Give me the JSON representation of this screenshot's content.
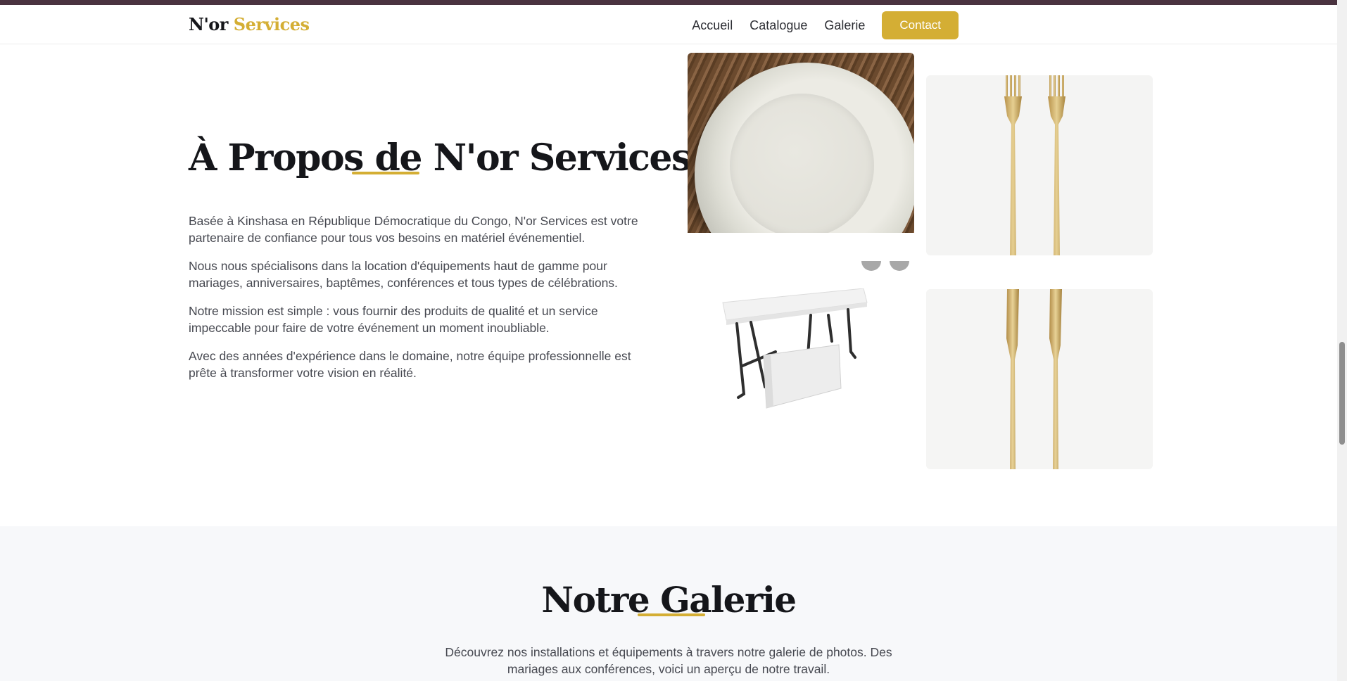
{
  "brand": {
    "name_part1": "N'or",
    "name_part2": "Services",
    "accent_color": "#d4ae34"
  },
  "nav": {
    "links": [
      "Accueil",
      "Catalogue",
      "Galerie"
    ],
    "cta": "Contact"
  },
  "about": {
    "title": "À Propos de N'or Services",
    "paragraphs": [
      "Basée à Kinshasa en République Démocratique du Congo, N'or Services est votre partenaire de confiance pour tous vos besoins en matériel événementiel.",
      "Nous nous spécialisons dans la location d'équipements haut de gamme pour mariages, anniversaires, baptêmes, conférences et tous types de célébrations.",
      "Notre mission est simple : vous fournir des produits de qualité et un service impeccable pour faire de votre événement un moment inoubliable.",
      "Avec des années d'expérience dans le domaine, notre équipe professionnelle est prête à transformer votre vision en réalité."
    ],
    "images": [
      "plate-photo",
      "gold-forks-photo",
      "folding-table-photo",
      "gold-knives-photo"
    ]
  },
  "gallery": {
    "title": "Notre Galerie",
    "description": "Découvrez nos installations et équipements à travers notre galerie de photos. Des mariages aux conférences, voici un aperçu de notre travail."
  }
}
